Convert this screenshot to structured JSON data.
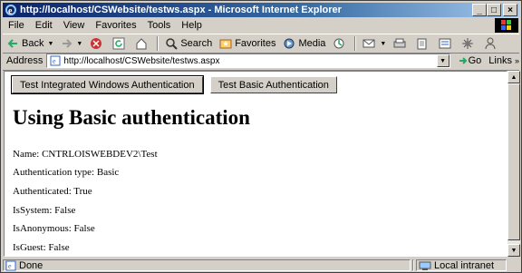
{
  "window": {
    "title": "http://localhost/CSWebsite/testws.aspx - Microsoft Internet Explorer",
    "controls": [
      "_",
      "□",
      "×"
    ]
  },
  "menubar": [
    "File",
    "Edit",
    "View",
    "Favorites",
    "Tools",
    "Help"
  ],
  "toolbar": {
    "back_label": "Back",
    "search_label": "Search",
    "favorites_label": "Favorites",
    "media_label": "Media"
  },
  "address": {
    "label": "Address",
    "url": "http://localhost/CSWebsite/testws.aspx",
    "go_label": "Go",
    "links_label": "Links"
  },
  "page": {
    "buttons": [
      "Test Integrated Windows Authentication",
      "Test Basic Authentication"
    ],
    "heading": "Using Basic authentication",
    "lines": [
      "Name: CNTRLOISWEBDEV2\\Test",
      "Authentication type: Basic",
      "Authenticated: True",
      "IsSystem: False",
      "IsAnonymous: False",
      "IsGuest: False"
    ]
  },
  "status": {
    "text": "Done",
    "zone": "Local intranet"
  },
  "colors": {
    "title_start": "#0a246a",
    "title_end": "#a6caf0",
    "chrome": "#d4d0c8"
  }
}
